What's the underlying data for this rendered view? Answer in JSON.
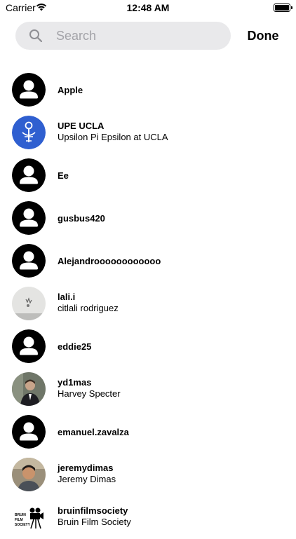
{
  "status": {
    "carrier": "Carrier",
    "time": "12:48 AM"
  },
  "search": {
    "placeholder": "Search",
    "value": ""
  },
  "done_label": "Done",
  "contacts": [
    {
      "name": "Apple",
      "subtitle": ""
    },
    {
      "name": "UPE UCLA",
      "subtitle": "Upsilon Pi Epsilon at UCLA"
    },
    {
      "name": "Ee",
      "subtitle": ""
    },
    {
      "name": "gusbus420",
      "subtitle": ""
    },
    {
      "name": "Alejandroooooooooooo",
      "subtitle": ""
    },
    {
      "name": "lali.i",
      "subtitle": "citlali rodriguez"
    },
    {
      "name": "eddie25",
      "subtitle": ""
    },
    {
      "name": "yd1mas",
      "subtitle": "Harvey Specter"
    },
    {
      "name": "emanuel.zavalza",
      "subtitle": ""
    },
    {
      "name": "jeremydimas",
      "subtitle": "Jeremy Dimas"
    },
    {
      "name": "bruinfilmsociety",
      "subtitle": "Bruin Film Society"
    }
  ],
  "logo_text": {
    "bruin_film_society": "BRUIN FILM SOCIETY"
  },
  "colors": {
    "search_bg": "#e9e9eb",
    "placeholder": "#a3a3a8",
    "upe_blue": "#2f5fd0"
  }
}
